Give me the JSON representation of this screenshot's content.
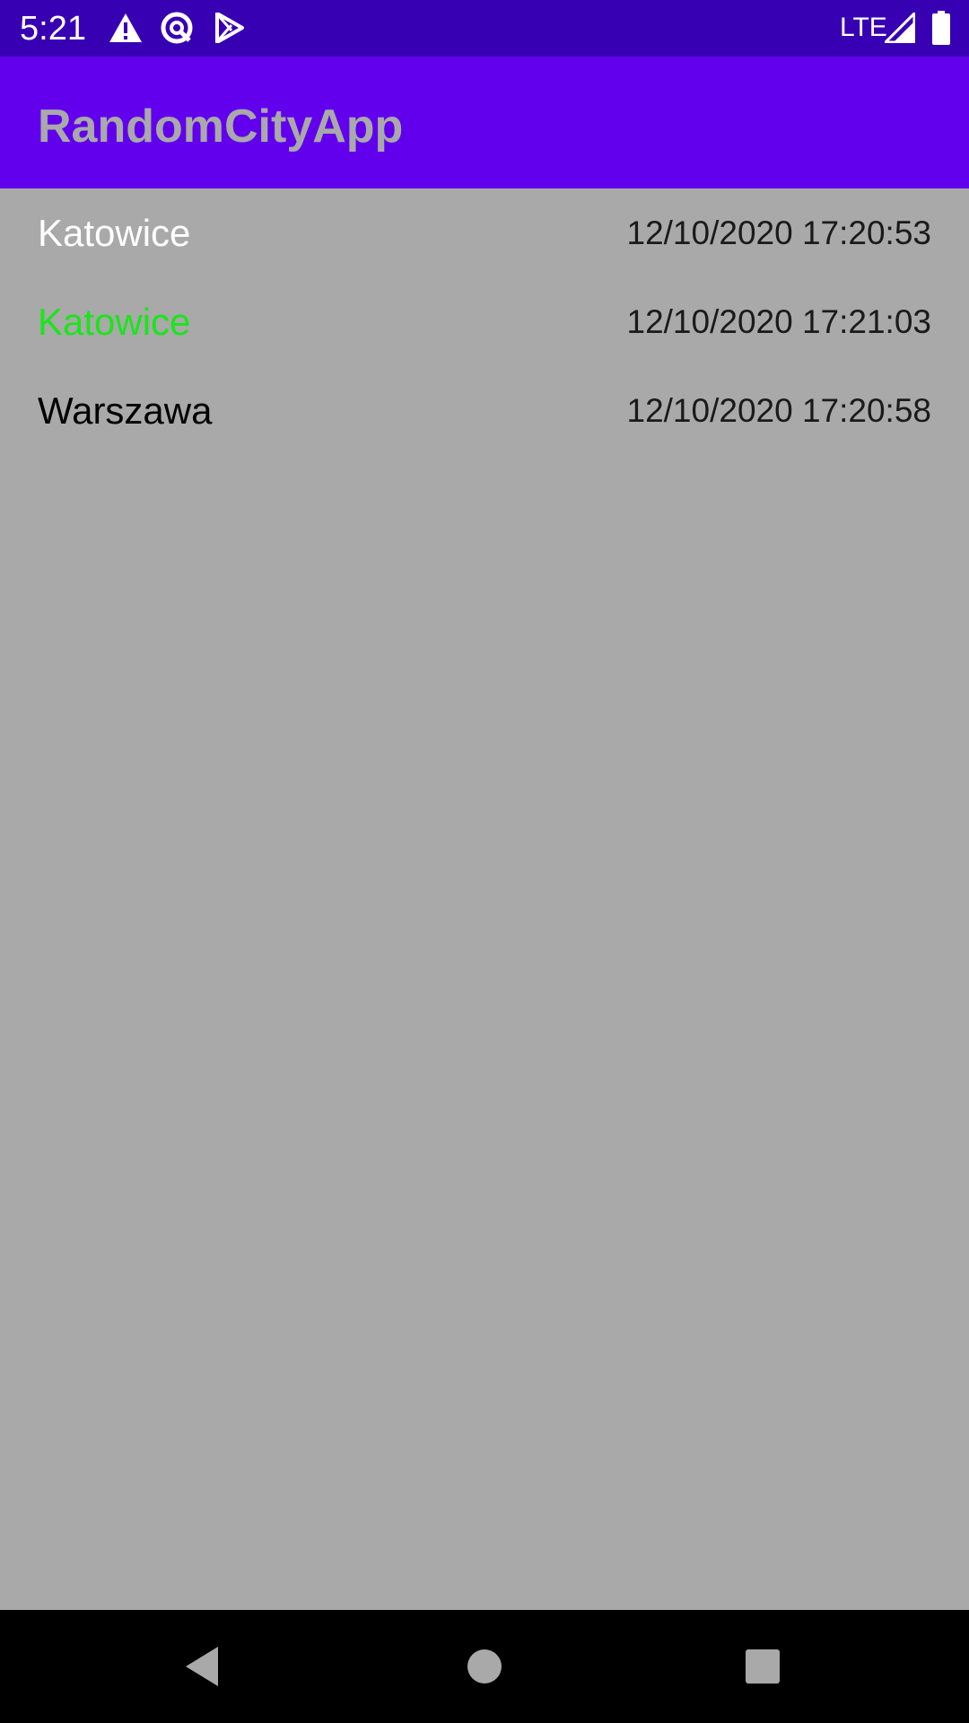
{
  "status_bar": {
    "time": "5:21",
    "network": "LTE",
    "icons": [
      "warning-icon",
      "vpn-icon",
      "play-store-icon",
      "signal-icon",
      "battery-icon"
    ],
    "background": "#3700b3"
  },
  "app_bar": {
    "title": "RandomCityApp",
    "background": "#6200ee",
    "title_color": "#a9a9a9"
  },
  "list": {
    "background": "#a9a9a9",
    "items": [
      {
        "city": "Katowice",
        "timestamp": "12/10/2020 17:20:53",
        "city_color": "#ffffff"
      },
      {
        "city": "Katowice",
        "timestamp": "12/10/2020 17:21:03",
        "city_color": "#19e619"
      },
      {
        "city": "Warszawa",
        "timestamp": "12/10/2020 17:20:58",
        "city_color": "#000000"
      }
    ]
  },
  "nav_bar": {
    "buttons": [
      "back-icon",
      "home-icon",
      "recents-icon"
    ]
  }
}
